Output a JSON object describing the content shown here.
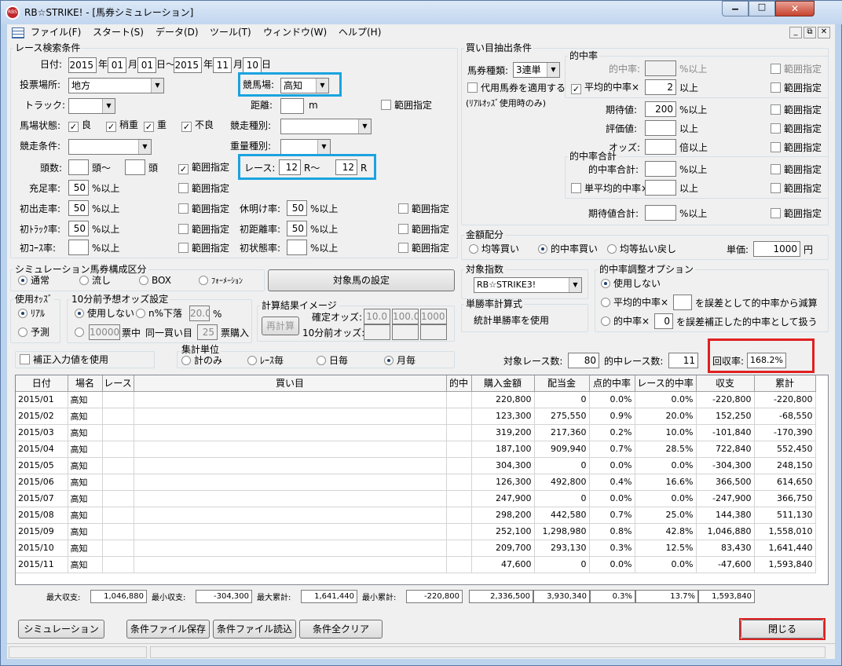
{
  "window": {
    "title": "RB☆STRIKE! - [馬券シミュレーション]",
    "min": "▁",
    "max": "□",
    "close": "✕",
    "app_icon": "RBS"
  },
  "menu": [
    "ファイル(F)",
    "スタート(S)",
    "データ(D)",
    "ツール(T)",
    "ウィンドウ(W)",
    "ヘルプ(H)"
  ],
  "race": {
    "title": "レース検索条件",
    "date_label": "日付:",
    "y1": "2015",
    "y1s": "年",
    "m1": "01",
    "m1s": "月",
    "d1": "01",
    "d1s": "日～",
    "y2": "2015",
    "y2s": "年",
    "m2": "11",
    "m2s": "月",
    "d2": "10",
    "d2s": "日",
    "venue_label": "投票場所:",
    "venue": "地方",
    "track_label": "競馬場:",
    "track": "高知",
    "course_label": "トラック:",
    "distance_label": "距離:",
    "distance_unit": "m",
    "range": "範囲指定",
    "cond_label": "馬場状態:",
    "cond": [
      "良",
      "稍重",
      "重",
      "不良"
    ],
    "racetype_label": "競走種別:",
    "racecond_label": "競走条件:",
    "weight_label": "重量種別:",
    "heads_label": "頭数:",
    "heads_u1": "頭～",
    "heads_u2": "頭",
    "racenum_label": "レース:",
    "racenum_from": "12",
    "racenum_from_u": "R～",
    "racenum_to": "12",
    "racenum_to_u": "R",
    "fill_label": "充足率:",
    "fill_val": "50",
    "pct_over": "%以上",
    "firstrun_label": "初出走率:",
    "firstrun_val": "50",
    "rest_label": "休明け率:",
    "rest_val": "50",
    "firsttrack_label": "初ﾄﾗｯｸ率:",
    "firsttrack_val": "50",
    "firstdist_label": "初距離率:",
    "firstdist_val": "50",
    "firstcourse_label": "初ｺｰｽ率:",
    "firstcond_label": "初状態率:"
  },
  "sim": {
    "title": "シミュレーション馬券構成区分",
    "opts": [
      "通常",
      "流し",
      "BOX",
      "ﾌｫｰﾒｰｼｮﾝ"
    ],
    "target_button": "対象馬の設定"
  },
  "odds": {
    "title": "使用ｵｯｽﾞ",
    "opts": [
      "ﾘｱﾙ",
      "予測"
    ]
  },
  "odds10": {
    "title": "10分前予想オッズ設定",
    "opt1": "使用しない",
    "opt2": "n%下落",
    "pct": "20.0",
    "pct_u": "%",
    "opt3_val": "10000",
    "opt3_a": "票中",
    "opt3_b": "同一買い目",
    "opt3_n": "25",
    "opt3_c": "票購入"
  },
  "calc": {
    "title": "計算結果イメージ",
    "btn": "再計算",
    "confirm": "確定オッズ:",
    "v1": "10.0",
    "v2": "100.0",
    "v3": "1000",
    "pre": "10分前オッズ:"
  },
  "fix": {
    "label": "補正入力値を使用"
  },
  "agg": {
    "title": "集計単位",
    "opts": [
      "計のみ",
      "ﾚｰｽ毎",
      "日毎",
      "月毎"
    ]
  },
  "buy": {
    "title": "買い目抽出条件",
    "ticket_label": "馬券種類:",
    "ticket": "3連単",
    "alt": "代用馬券を適用する",
    "alt2": "(ﾘｱﾙｵｯｽﾞ使用時のみ)",
    "hit_title": "的中率",
    "hit": "的中率:",
    "hit_u": "%以上",
    "avg": "平均的中率×",
    "avg_val": "2",
    "avg_u": "以上",
    "exp": "期待値:",
    "exp_val": "200",
    "exp_u": "%以上",
    "eval": "評価値:",
    "eval_u": "以上",
    "odds": "オッズ:",
    "odds_u": "倍以上",
    "sum_title": "的中率合計",
    "sum": "的中率合計:",
    "sum_u": "%以上",
    "single": "単平均的中率×",
    "single_u": "以上",
    "expsum": "期待値合計:",
    "expsum_u": "%以上",
    "range": "範囲指定"
  },
  "money": {
    "title": "金額配分",
    "opts": [
      "均等買い",
      "的中率買い",
      "均等払い戻し"
    ],
    "unit_label": "単価:",
    "unit": "1000",
    "unit_u": "円"
  },
  "idx": {
    "title": "対象指数",
    "value": "RB☆STRIKE3!"
  },
  "adj": {
    "title": "的中率調整オプション",
    "opt1": "使用しない",
    "opt2a": "平均的中率×",
    "opt2b": "を誤差として的中率から減算",
    "opt3a": "的中率×",
    "opt3_val": "0",
    "opt3b": "を誤差補正した的中率として扱う"
  },
  "win_calc": {
    "title": "単勝率計算式",
    "text": "統計単勝率を使用"
  },
  "stats": {
    "target_label": "対象レース数:",
    "target": "80",
    "hit_label": "的中レース数:",
    "hit": "11",
    "recovery_label": "回収率:",
    "recovery": "168.2%"
  },
  "table": {
    "headers": [
      "日付",
      "場名",
      "レース",
      "買い目",
      "的中",
      "購入金額",
      "配当金",
      "点的中率",
      "レース的中率",
      "収支",
      "累計"
    ],
    "rows": [
      [
        "2015/01",
        "高知",
        "",
        "",
        "",
        "220,800",
        "0",
        "0.0%",
        "0.0%",
        "-220,800",
        "-220,800"
      ],
      [
        "2015/02",
        "高知",
        "",
        "",
        "",
        "123,300",
        "275,550",
        "0.9%",
        "20.0%",
        "152,250",
        "-68,550"
      ],
      [
        "2015/03",
        "高知",
        "",
        "",
        "",
        "319,200",
        "217,360",
        "0.2%",
        "10.0%",
        "-101,840",
        "-170,390"
      ],
      [
        "2015/04",
        "高知",
        "",
        "",
        "",
        "187,100",
        "909,940",
        "0.7%",
        "28.5%",
        "722,840",
        "552,450"
      ],
      [
        "2015/05",
        "高知",
        "",
        "",
        "",
        "304,300",
        "0",
        "0.0%",
        "0.0%",
        "-304,300",
        "248,150"
      ],
      [
        "2015/06",
        "高知",
        "",
        "",
        "",
        "126,300",
        "492,800",
        "0.4%",
        "16.6%",
        "366,500",
        "614,650"
      ],
      [
        "2015/07",
        "高知",
        "",
        "",
        "",
        "247,900",
        "0",
        "0.0%",
        "0.0%",
        "-247,900",
        "366,750"
      ],
      [
        "2015/08",
        "高知",
        "",
        "",
        "",
        "298,200",
        "442,580",
        "0.7%",
        "25.0%",
        "144,380",
        "511,130"
      ],
      [
        "2015/09",
        "高知",
        "",
        "",
        "",
        "252,100",
        "1,298,980",
        "0.8%",
        "42.8%",
        "1,046,880",
        "1,558,010"
      ],
      [
        "2015/10",
        "高知",
        "",
        "",
        "",
        "209,700",
        "293,130",
        "0.3%",
        "12.5%",
        "83,430",
        "1,641,440"
      ],
      [
        "2015/11",
        "高知",
        "",
        "",
        "",
        "47,600",
        "0",
        "0.0%",
        "0.0%",
        "-47,600",
        "1,593,840"
      ]
    ]
  },
  "summary": {
    "max_label": "最大収支:",
    "max": "1,046,880",
    "min_label": "最小収支:",
    "min": "-304,300",
    "maxcum_label": "最大累計:",
    "maxcum": "1,641,440",
    "mincum_label": "最小累計:",
    "mincum": "-220,800",
    "buy": "2,336,500",
    "pay": "3,930,340",
    "pt": "0.3%",
    "race": "13.7%",
    "bal": "1,593,840"
  },
  "buttons": {
    "sim": "シミュレーション",
    "save": "条件ファイル保存",
    "load": "条件ファイル読込",
    "clear": "条件全クリア",
    "close": "閉じる"
  },
  "check": "✓"
}
